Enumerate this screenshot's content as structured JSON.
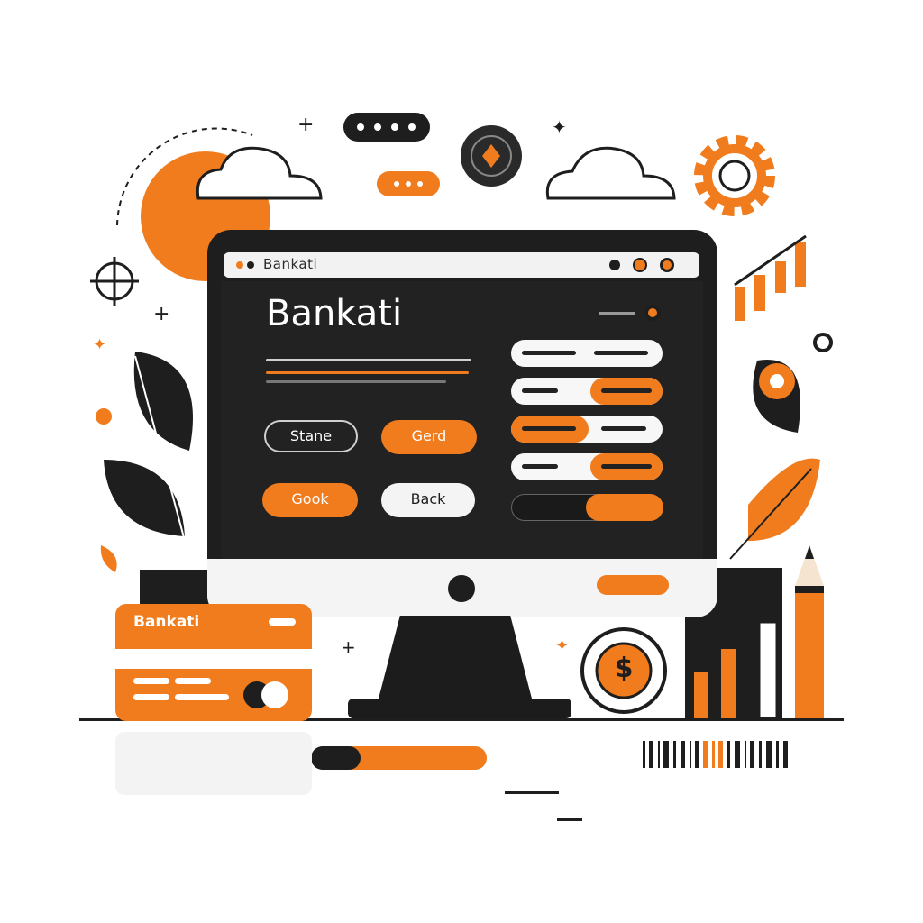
{
  "window": {
    "title": "Bankati"
  },
  "hero": {
    "brand": "Bankati"
  },
  "buttons": {
    "outline_label": "Stane",
    "orange_label": "Gerd",
    "orange2_label": "Gook",
    "white_label": "Back"
  },
  "card": {
    "name": "Bankati"
  },
  "coin": {
    "symbol": "$"
  },
  "colors": {
    "accent": "#f07c1e",
    "dark": "#1e1e1e",
    "light": "#f4f4f4"
  },
  "icons": [
    "cloud-icon",
    "gear-icon",
    "crosshair-icon",
    "compass-icon",
    "leaf-icon",
    "pencil-icon",
    "barcode-icon",
    "sun-icon",
    "coin-icon",
    "bar-chart-icon"
  ]
}
